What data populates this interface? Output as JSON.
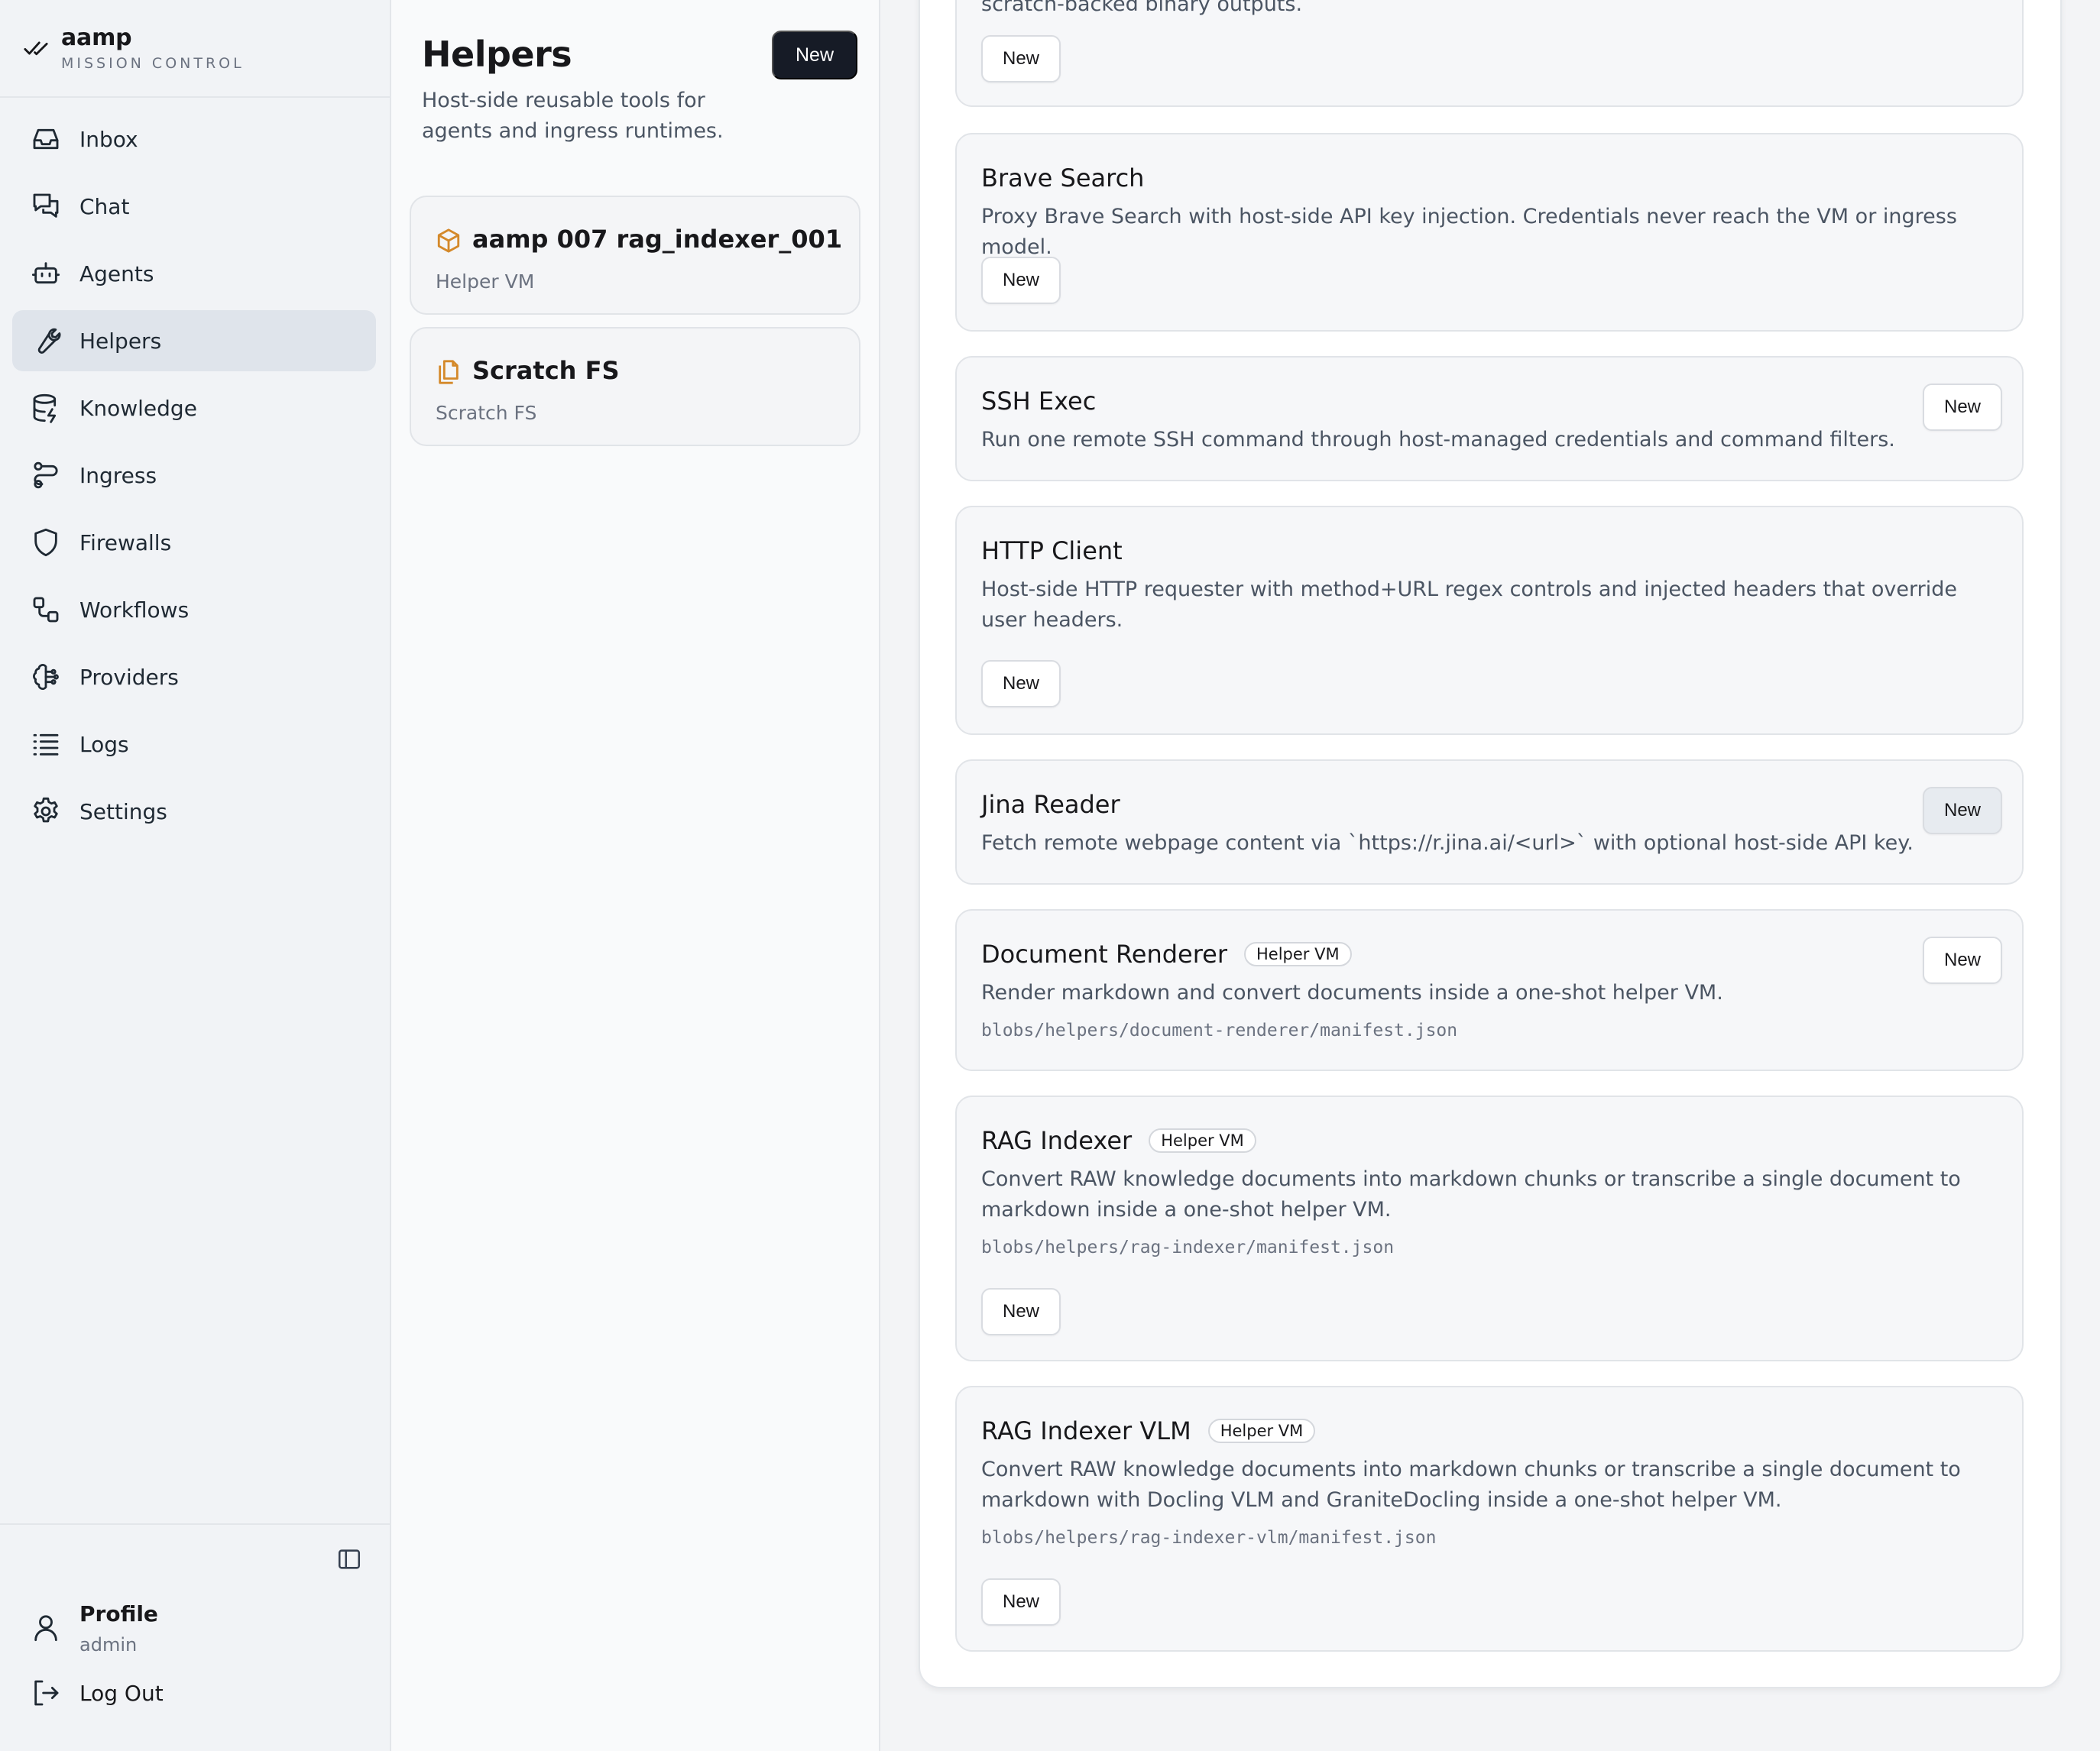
{
  "app": {
    "name": "aamp",
    "subtitle": "MISSION CONTROL"
  },
  "sidebar": {
    "items": [
      {
        "label": "Inbox",
        "icon": "inbox-icon"
      },
      {
        "label": "Chat",
        "icon": "chat-icon"
      },
      {
        "label": "Agents",
        "icon": "robot-icon"
      },
      {
        "label": "Helpers",
        "icon": "wrench-icon",
        "active": true
      },
      {
        "label": "Knowledge",
        "icon": "database-icon"
      },
      {
        "label": "Ingress",
        "icon": "route-icon"
      },
      {
        "label": "Firewalls",
        "icon": "shield-icon"
      },
      {
        "label": "Workflows",
        "icon": "workflow-icon"
      },
      {
        "label": "Providers",
        "icon": "brain-icon"
      },
      {
        "label": "Logs",
        "icon": "list-icon"
      },
      {
        "label": "Settings",
        "icon": "gear-icon"
      }
    ],
    "profile": {
      "name": "Profile",
      "role": "admin"
    },
    "logout": "Log Out"
  },
  "helpers": {
    "title": "Helpers",
    "description": "Host-side reusable tools for agents and ingress runtimes.",
    "new_button": "New",
    "list": [
      {
        "title": "aamp 007 rag_indexer_001",
        "subtitle": "Helper VM",
        "icon": "cube-icon"
      },
      {
        "title": "Scratch FS",
        "subtitle": "Scratch FS",
        "icon": "files-icon"
      }
    ]
  },
  "templates": {
    "clipped_text": "scratch-backed binary outputs.",
    "new_label": "New",
    "items": [
      {
        "title": "Brave Search",
        "description": "Proxy Brave Search with host-side API key injection. Credentials never reach the VM or ingress model."
      },
      {
        "title": "SSH Exec",
        "description": "Run one remote SSH command through host-managed credentials and command filters."
      },
      {
        "title": "HTTP Client",
        "description": "Host-side HTTP requester with method+URL regex controls and injected headers that override user headers."
      },
      {
        "title": "Jina Reader",
        "description": "Fetch remote webpage content via `https://r.jina.ai/<url>` with optional host-side API key."
      },
      {
        "title": "Document Renderer",
        "badge": "Helper VM",
        "description": "Render markdown and convert documents inside a one-shot helper VM.",
        "path": "blobs/helpers/document-renderer/manifest.json"
      },
      {
        "title": "RAG Indexer",
        "badge": "Helper VM",
        "description": "Convert RAW knowledge documents into markdown chunks or transcribe a single document to markdown inside a one-shot helper VM.",
        "path": "blobs/helpers/rag-indexer/manifest.json"
      },
      {
        "title": "RAG Indexer VLM",
        "badge": "Helper VM",
        "description": "Convert RAW knowledge documents into markdown chunks or transcribe a single document to markdown with Docling VLM and GraniteDocling inside a one-shot helper VM.",
        "path": "blobs/helpers/rag-indexer-vlm/manifest.json"
      }
    ]
  }
}
